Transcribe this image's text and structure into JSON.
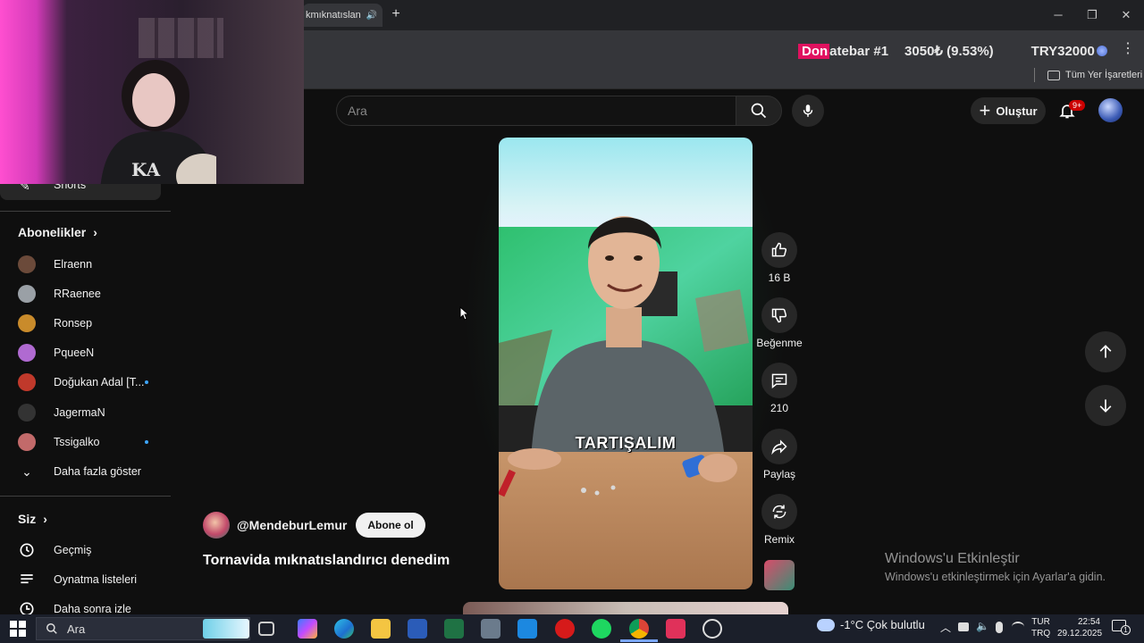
{
  "browser": {
    "tab_title": "kmıknatıslan",
    "new_tab": "+",
    "window_controls": {
      "minimize": "─",
      "maximize": "❐",
      "close": "✕"
    },
    "bookmarks_all": "Tüm Yer İşaretleri"
  },
  "donate_bar": {
    "pink_part": "Don",
    "rest": "atebar #1",
    "amount": "3050₺ (9.53%)",
    "goal": "TRY32000"
  },
  "header": {
    "search_placeholder": "Ara",
    "create_label": "Oluştur",
    "notification_badge": "9+"
  },
  "sidebar": {
    "shorts_label": "Shorts",
    "subscriptions_heading": "Abonelikler",
    "subscriptions": [
      {
        "name": "Elraenn",
        "color": "#6b4a3a",
        "new": false
      },
      {
        "name": "RRaenee",
        "color": "#9aa0a6",
        "new": false
      },
      {
        "name": "Ronsep",
        "color": "#c98b2b",
        "new": false
      },
      {
        "name": "PqueeN",
        "color": "#b06ad1",
        "new": false
      },
      {
        "name": "Doğukan Adal [T...",
        "color": "#c0392b",
        "new": true
      },
      {
        "name": "JagermaN",
        "color": "#333333",
        "new": false
      },
      {
        "name": "Tssigalko",
        "color": "#c26a6a",
        "new": true
      }
    ],
    "show_more": "Daha fazla göster",
    "you_heading": "Siz",
    "you_items": [
      {
        "label": "Geçmiş",
        "icon": "history-icon"
      },
      {
        "label": "Oynatma listeleri",
        "icon": "playlist-icon"
      },
      {
        "label": "Daha sonra izle",
        "icon": "watch-later-icon"
      }
    ]
  },
  "video": {
    "caption": "TARTIŞALIM",
    "channel": "@MendeburLemur",
    "subscribe": "Abone ol",
    "title": "Tornavida mıknatıslandırıcı denedim"
  },
  "actions": {
    "likes": "16 B",
    "dislike": "Beğenme",
    "comments": "210",
    "share": "Paylaş",
    "remix": "Remix"
  },
  "activate_windows": {
    "title": "Windows'u Etkinleştir",
    "subtitle": "Windows'u etkinleştirmek için Ayarlar'a gidin."
  },
  "taskbar": {
    "search": "Ara",
    "weather": "-1°C  Çok bulutlu",
    "lang_1": "TUR",
    "lang_2": "TRQ",
    "time": "22:54",
    "date": "29.12.2025",
    "notif_count": "1"
  }
}
